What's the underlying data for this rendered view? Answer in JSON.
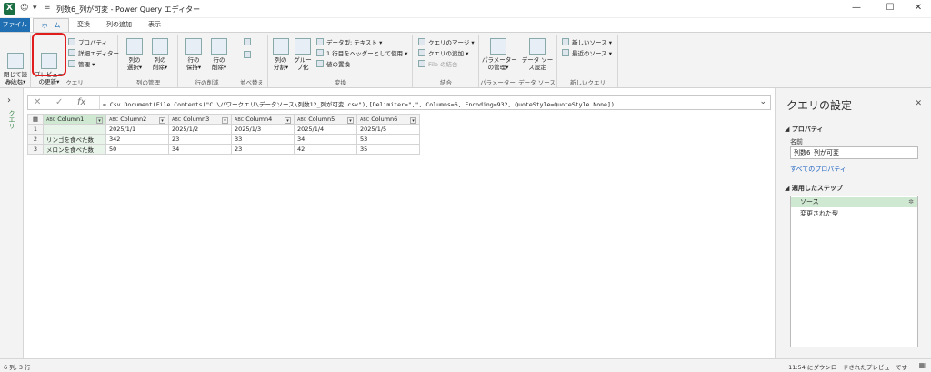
{
  "titlebar": {
    "title": "列数6_列が可変 - Power Query エディター",
    "excel_icon": "X",
    "smiley": "☺",
    "dropdown": "▾",
    "eq": "="
  },
  "window": {
    "minimize": "—",
    "maximize": "☐",
    "close": "✕"
  },
  "tabs": [
    "ファイル",
    "ホーム",
    "変換",
    "列の追加",
    "表示"
  ],
  "ribbon": {
    "close_load": "閉じて読\nみ込む▾",
    "close_group": "閉じる",
    "preview": "プレビュー\nの更新▾",
    "properties": "プロパティ",
    "adv_editor": "詳細エディター",
    "manage": "管理 ▾",
    "query_group": "クエリ",
    "choose_cols": "列の\n選択▾",
    "remove_cols": "列の\n削除▾",
    "col_mgmt_group": "列の管理",
    "keep_rows": "行の\n保持▾",
    "remove_rows": "行の\n削除▾",
    "row_reduce_group": "行の削減",
    "sort_group": "並べ替え",
    "split_col": "列の\n分割▾",
    "group_by": "グルー\nプ化",
    "datatype": "データ型: テキスト ▾",
    "use_header": "1 行目をヘッダーとして使用 ▾",
    "replace": "値の置換",
    "transform_group": "変換",
    "merge_q": "クエリのマージ ▾",
    "append_q": "クエリの追加 ▾",
    "combine_files": "File の結合",
    "combine_group": "結合",
    "params": "パラメーター\nの管理▾",
    "params_group": "パラメーター",
    "ds_settings": "データ ソー\nス設定",
    "ds_group": "データ ソース",
    "new_source": "新しいソース ▾",
    "recent_source": "最近のソース ▾",
    "newq_group": "新しいクエリ"
  },
  "leftpane": {
    "chevron": "›",
    "label": "クエリ"
  },
  "formula": {
    "cancel": "✕",
    "commit": "✓",
    "fx": "fx",
    "text": "= Csv.Document(File.Contents(\"C:\\パワークエリ\\データソース\\列数12_列が可変.csv\"),[Delimiter=\",\", Columns=6, Encoding=932, QuoteStyle=QuoteStyle.None])",
    "dropdown": "⌄"
  },
  "table": {
    "type_icon": "ABC",
    "columns": [
      "Column1",
      "Column2",
      "Column3",
      "Column4",
      "Column5",
      "Column6"
    ],
    "rows": [
      [
        "1",
        "",
        "2025/1/1",
        "2025/1/2",
        "2025/1/3",
        "2025/1/4",
        "2025/1/5"
      ],
      [
        "2",
        "リンゴを食べた数",
        "342",
        "23",
        "33",
        "34",
        "53"
      ],
      [
        "3",
        "メロンを食べた数",
        "50",
        "34",
        "23",
        "42",
        "35"
      ]
    ]
  },
  "settings": {
    "title": "クエリの設定",
    "close": "✕",
    "props_header": "◢ プロパティ",
    "name_label": "名前",
    "name_value": "列数6_列が可変",
    "all_props": "すべてのプロパティ",
    "steps_header": "◢ 適用したステップ",
    "steps": [
      "ソース",
      "変更された型"
    ],
    "gear": "✲"
  },
  "status": {
    "left": "6 列, 3 行",
    "right": "11:54 にダウンロードされたプレビューです",
    "icon": "▦"
  }
}
